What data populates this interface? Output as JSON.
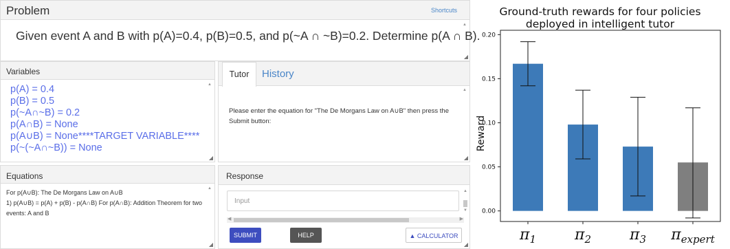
{
  "problem": {
    "title": "Problem",
    "shortcuts": "Shortcuts",
    "text": "Given event A and B with p(A)=0.4, p(B)=0.5, and p(~A ∩ ~B)=0.2. Determine p(A ∩ B)."
  },
  "variables": {
    "title": "Variables",
    "items": [
      "p(A) = 0.4",
      "p(B) = 0.5",
      "p(~A∩~B) = 0.2",
      "p(A∩B) = None",
      "p(A∪B) = None****TARGET VARIABLE****",
      "p(~(~A∩~B)) = None"
    ]
  },
  "tabs": {
    "tutor": "Tutor",
    "history": "History",
    "message": "Please enter the equation for \"The De Morgans Law on A∪B\" then press the Submit button:"
  },
  "equations": {
    "title": "Equations",
    "line1": "For p(A∪B): The De Morgans Law on A∪B",
    "line2": "1) p(A∪B) = p(A) + p(B) - p(A∩B) For p(A∩B): Addition Theorem for two events: A and B"
  },
  "response": {
    "title": "Response",
    "placeholder": "Input",
    "submit": "SUBMIT",
    "help": "HELP",
    "calculator": "▲ CALCULATOR"
  },
  "chart_data": {
    "type": "bar",
    "title": "Ground-truth rewards for four policies deployed in intelligent tutor",
    "title_lines": [
      "Ground-truth rewards for four policies",
      "deployed in intelligent tutor"
    ],
    "xlabel": "",
    "ylabel": "Reward",
    "categories": [
      "π₁",
      "π₂",
      "π₃",
      "πexpert"
    ],
    "category_parts": [
      {
        "base": "π",
        "sub": "1"
      },
      {
        "base": "π",
        "sub": "2"
      },
      {
        "base": "π",
        "sub": "3"
      },
      {
        "base": "π",
        "sub": "expert"
      }
    ],
    "values": [
      0.167,
      0.098,
      0.073,
      0.055
    ],
    "error_low": [
      0.142,
      0.059,
      0.017,
      -0.008
    ],
    "error_high": [
      0.192,
      0.137,
      0.129,
      0.117
    ],
    "colors": [
      "#3d7ab8",
      "#3d7ab8",
      "#3d7ab8",
      "#7f7f7f"
    ],
    "ylim": [
      -0.012,
      0.205
    ],
    "yticks": [
      0.0,
      0.05,
      0.1,
      0.15,
      0.2
    ],
    "ytick_labels": [
      "0.00",
      "0.05",
      "0.10",
      "0.15",
      "0.20"
    ],
    "grid": false
  }
}
